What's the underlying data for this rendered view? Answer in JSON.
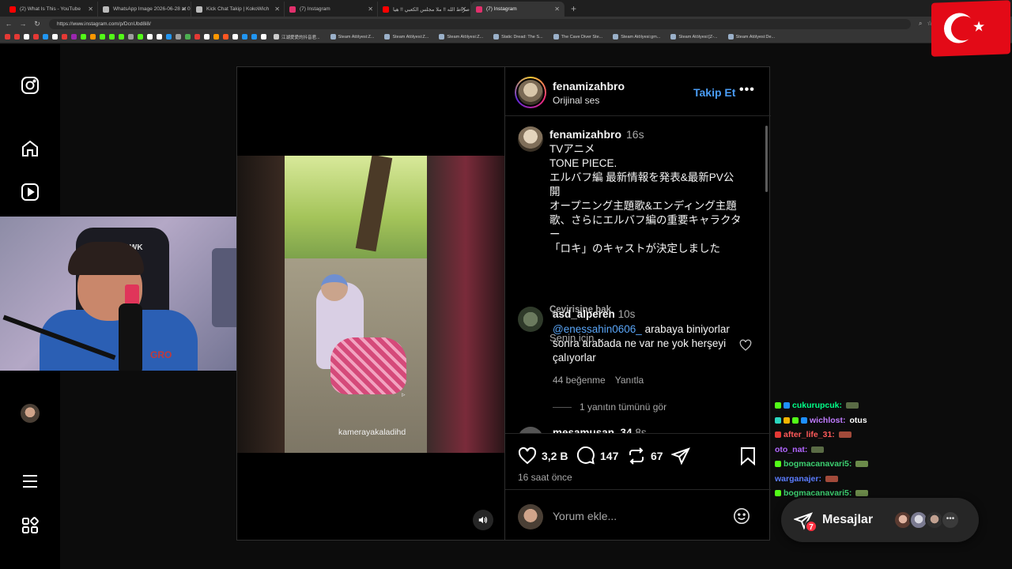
{
  "browser": {
    "tabs": [
      {
        "title": "(2) What Is This - YouTube",
        "favicon_color": "#ff0000",
        "active": false
      },
      {
        "title": "WhatsApp Image 2026-06-28 at 0",
        "favicon_color": "#bbbbbb",
        "active": false
      },
      {
        "title": "Kick Chat Takip | KokoWich",
        "favicon_color": "#bbbbbb",
        "active": false
      },
      {
        "title": "(7) Instagram",
        "favicon_color": "#e1306c",
        "active": false
      },
      {
        "title": "صراط الله !! ملا مجلس الكعبي !! هيا",
        "favicon_color": "#ff0000",
        "active": false
      },
      {
        "title": "(7) Instagram",
        "favicon_color": "#e1306c",
        "active": true
      }
    ],
    "new_tab": "+",
    "url": "https://www.instagram.com/p/DcnUbd8i8/",
    "bookmarks": [
      {
        "label": "江湖愛愛的抖音君...",
        "color": "#cccccc"
      },
      {
        "label": "Steam Atölyesi:Z...",
        "color": "#9ab0c9"
      },
      {
        "label": "Steam Atölyesi:Z...",
        "color": "#9ab0c9"
      },
      {
        "label": "Steam Atölyesi:Z...",
        "color": "#9ab0c9"
      },
      {
        "label": "Static Dread: The S...",
        "color": "#9ab0c9"
      },
      {
        "label": "The Cave Diver Ste...",
        "color": "#9ab0c9"
      },
      {
        "label": "Steam Atölyesi:gm...",
        "color": "#9ab0c9"
      },
      {
        "label": "Steam Atölyesi:[Z-...",
        "color": "#9ab0c9"
      },
      {
        "label": "Steam Atölyesi:De...",
        "color": "#9ab0c9"
      }
    ],
    "bookmark_icon_colors": [
      "#e53935",
      "#e53935",
      "#ffffff",
      "#e53935",
      "#2196f3",
      "#ffffff",
      "#e53935",
      "#9c27b0",
      "#53fc18",
      "#ff9800",
      "#53fc18",
      "#53fc18",
      "#53fc18",
      "#9e9e9e",
      "#53fc18",
      "#ffffff",
      "#ffffff",
      "#2196f3",
      "#9e9e9e",
      "#4caf50",
      "#e53935",
      "#ffffff",
      "#ff9800",
      "#ff5722",
      "#ffffff",
      "#2196f3",
      "#2196f3",
      "#ffffff"
    ]
  },
  "post": {
    "header": {
      "username": "fenamizahbro",
      "subtitle": "Orijinal ses",
      "follow_label": "Takip Et",
      "more": "•••"
    },
    "caption": {
      "username": "fenamizahbro",
      "time": "16s",
      "lines": [
        "TVアニメ",
        "TONE PIECE.",
        "エルバフ編 最新情報を発表&最新PV公",
        "開",
        "オープニング主題歌&エンディング主題",
        "歌、さらにエルバフ編の重要キャラクタ",
        "ー",
        "「ロキ」のキャストが決定しました"
      ],
      "translate": "Çevirisine bak"
    },
    "for_you": "Senin için",
    "comments": [
      {
        "username": "asd_alperen",
        "time": "10s",
        "mention": "@enessahin0606_",
        "text": "arabaya biniyorlar sonra arabada ne var ne yok herşeyi çalıyorlar",
        "likes": "44 beğenme",
        "reply": "Yanıtla",
        "view_replies": "1 yanıtın tümünü gör"
      },
      {
        "username": "mesamusan_34",
        "time": "8s"
      }
    ],
    "watermark": "kamerayakaladihd",
    "actions": {
      "likes": "3,2 B",
      "comments": "147",
      "reposts": "67"
    },
    "time_ago": "16 saat önce",
    "add_comment_placeholder": "Yorum ekle..."
  },
  "chat": [
    {
      "user": "cukurupcuk:",
      "color": "#00ff88",
      "text": "",
      "badges": [
        "#53fc18",
        "#1e90ff"
      ],
      "emote": "#5a6b45"
    },
    {
      "user": "wichlost:",
      "color": "#c07cff",
      "text": "otus",
      "badges": [
        "#2bd8c0",
        "#f5b400",
        "#53fc18",
        "#1e90ff"
      ],
      "emote": ""
    },
    {
      "user": "after_life_31:",
      "color": "#ff5a5a",
      "text": "",
      "badges": [
        "#e53935"
      ],
      "emote": "#a24a3a"
    },
    {
      "user": "oto_nat:",
      "color": "#b266ff",
      "text": "",
      "badges": [],
      "emote": "#5a6b45"
    },
    {
      "user": "bogmacanavari5:",
      "color": "#3cd070",
      "text": "",
      "badges": [
        "#53fc18"
      ],
      "emote": "#6b8a4a"
    },
    {
      "user": "warganajer:",
      "color": "#5b7cff",
      "text": "",
      "badges": [],
      "emote": "#a24a3a"
    },
    {
      "user": "bogmacanavari5:",
      "color": "#3cd070",
      "text": "",
      "badges": [
        "#53fc18"
      ],
      "emote": "#6b8a4a"
    }
  ],
  "messages": {
    "label": "Mesajlar",
    "unread": "7",
    "more": "•••"
  },
  "webcam": {
    "chair_text": "HAWK",
    "shirt_text": "GRO"
  }
}
